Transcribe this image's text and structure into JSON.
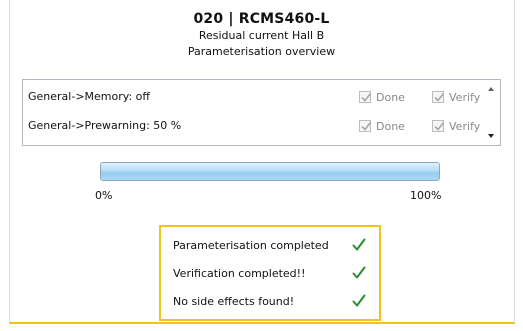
{
  "header": {
    "title": "020 | RCMS460-L",
    "subtitle": "Residual current Hall B",
    "caption": "Parameterisation overview"
  },
  "params": {
    "items": [
      {
        "label": "General->Memory: off",
        "done_label": "Done",
        "verify_label": "Verify",
        "done": true,
        "verify": true
      },
      {
        "label": "General->Prewarning: 50 %",
        "done_label": "Done",
        "verify_label": "Verify",
        "done": true,
        "verify": true
      }
    ]
  },
  "progress": {
    "value": 1.0,
    "min_label": "0%",
    "max_label": "100%"
  },
  "summary": {
    "items": [
      {
        "text": "Parameterisation completed",
        "icon": "checkmark-icon"
      },
      {
        "text": "Verification completed!!",
        "icon": "checkmark-icon"
      },
      {
        "text": "No side effects found!",
        "icon": "checkmark-icon"
      }
    ]
  },
  "colors": {
    "accent_border": "#f0c419",
    "check_green": "#2e8b2e",
    "disabled_text": "#8a8a8a",
    "progress_fill": "#a9d7f4"
  }
}
